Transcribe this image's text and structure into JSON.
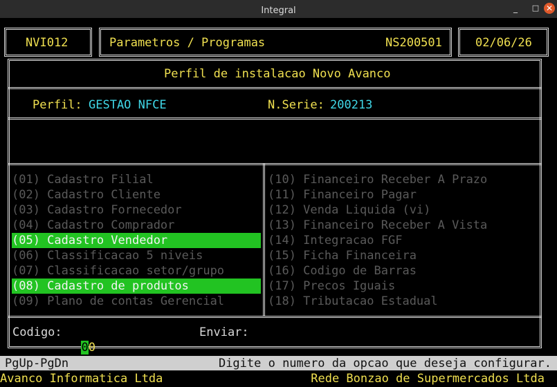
{
  "window": {
    "title": "Integral",
    "minimize_glyph": "_",
    "maximize_glyph": "□",
    "close_glyph": "✕"
  },
  "header": {
    "program_code": "NVI012",
    "module_title": "Parametros / Programas",
    "serial_code": "NS200501",
    "date": "02/06/26"
  },
  "panel": {
    "title": "Perfil de instalacao Novo Avanco",
    "profile_label": "Perfil:",
    "profile_value": "GESTAO NFCE",
    "serial_label": "N.Serie:",
    "serial_value": "200213"
  },
  "menu": {
    "left": [
      {
        "label": "(01) Cadastro Filial",
        "selected": false
      },
      {
        "label": "(02) Cadastro Cliente",
        "selected": false
      },
      {
        "label": "(03) Cadastro Fornecedor",
        "selected": false
      },
      {
        "label": "(04) Cadastro Comprador",
        "selected": false
      },
      {
        "label": "(05) Cadastro Vendedor",
        "selected": true
      },
      {
        "label": "(06) Classificacao 5 niveis",
        "selected": false
      },
      {
        "label": "(07) Classificacao setor/grupo",
        "selected": false
      },
      {
        "label": "(08) Cadastro de produtos",
        "selected": true
      },
      {
        "label": "(09) Plano de contas Gerencial",
        "selected": false
      }
    ],
    "right": [
      {
        "label": "(10) Financeiro Receber A Prazo",
        "selected": false
      },
      {
        "label": "(11) Financeiro Pagar",
        "selected": false
      },
      {
        "label": "(12) Venda Liquida (vi)",
        "selected": false
      },
      {
        "label": "(13) Financeiro Receber A Vista",
        "selected": false
      },
      {
        "label": "(14) Integracao FGF",
        "selected": false
      },
      {
        "label": "(15) Ficha Financeira",
        "selected": false
      },
      {
        "label": "(16) Codigo de Barras",
        "selected": false
      },
      {
        "label": "(17) Precos Iguais",
        "selected": false
      },
      {
        "label": "(18) Tributacao Estadual",
        "selected": false
      }
    ]
  },
  "input": {
    "codigo_label": "Codigo:",
    "codigo_cursor_char": "0",
    "codigo_rest": "0",
    "enviar_label": "Enviar:"
  },
  "status": {
    "keys_hint": "PgUp-PgDn",
    "message": "Digite o numero da opcao que deseja configurar."
  },
  "footer": {
    "company": "Avanco Informatica Ltda",
    "client": "Rede Bonzao de Supermercados Ltda"
  }
}
